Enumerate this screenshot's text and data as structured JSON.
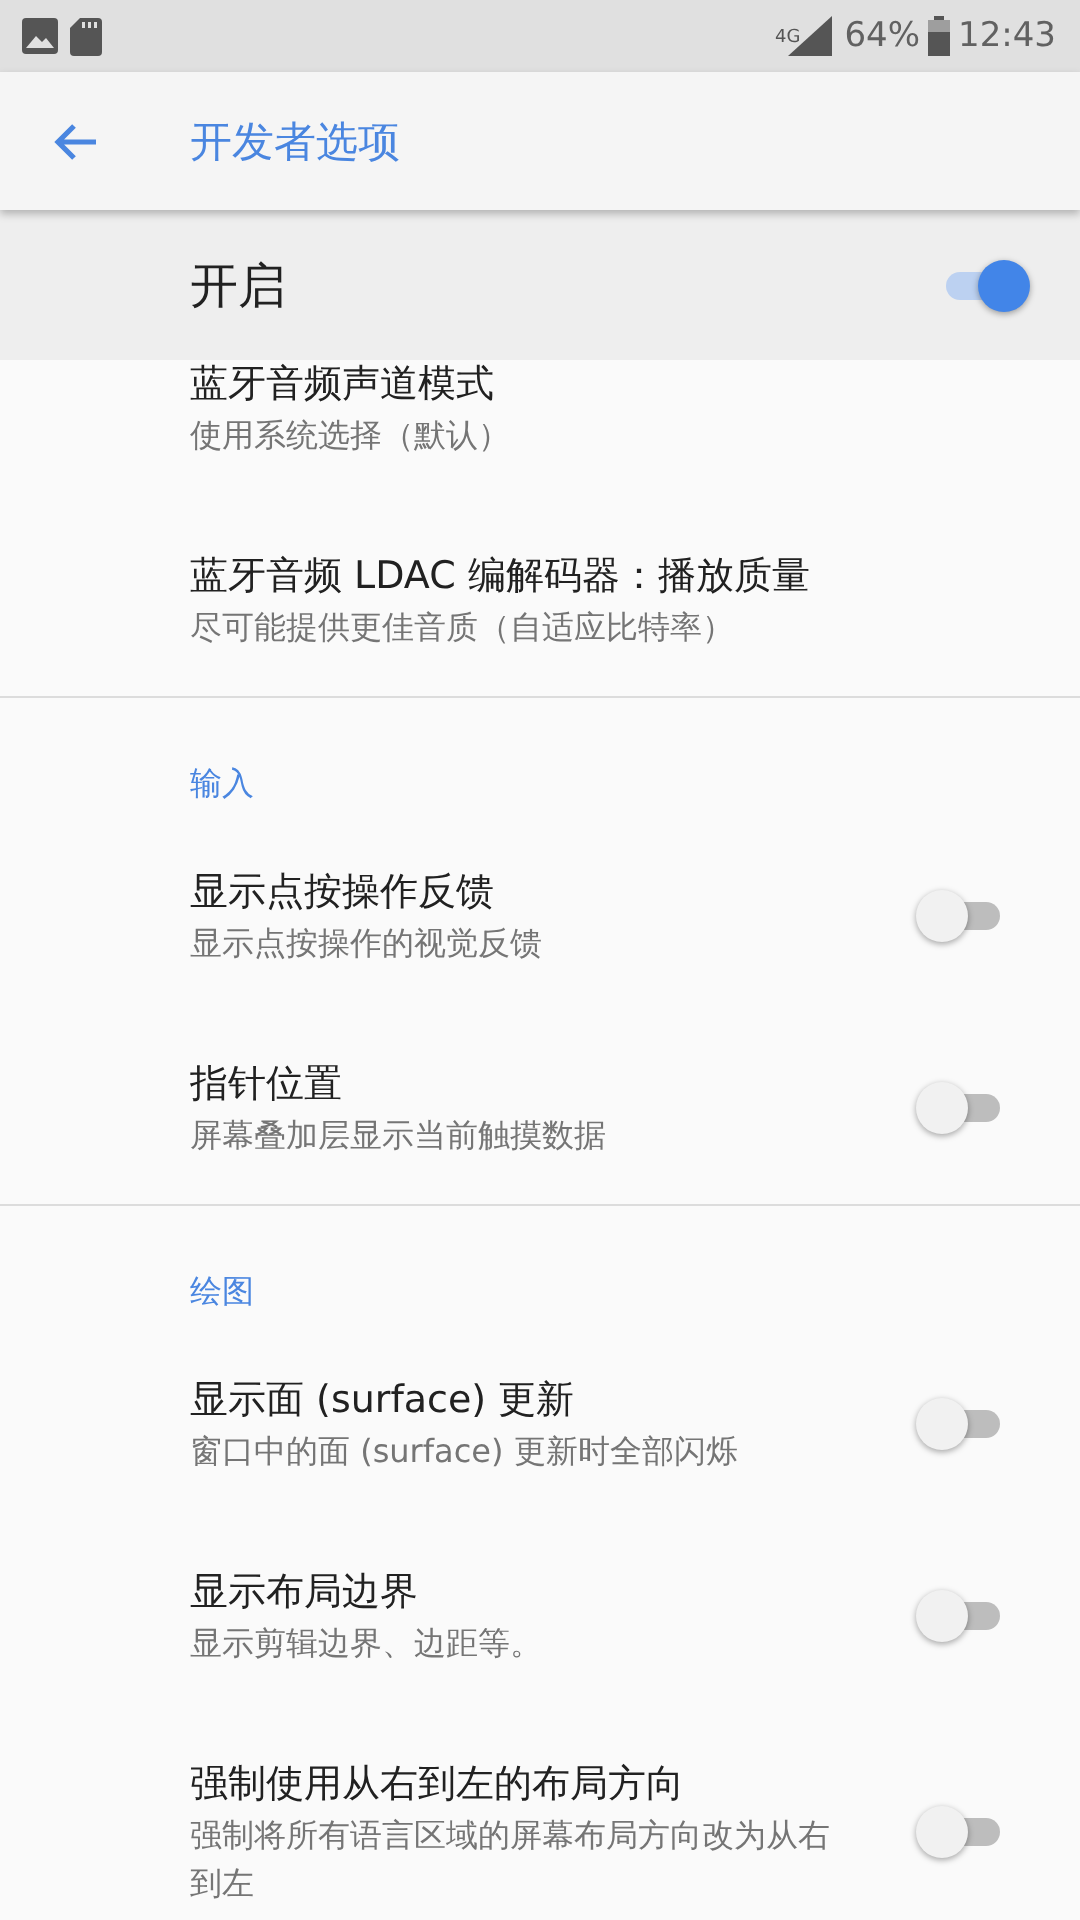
{
  "status_bar": {
    "network": "4G",
    "battery": "64%",
    "time": "12:43"
  },
  "toolbar": {
    "title": "开发者选项"
  },
  "master_switch": {
    "label": "开启",
    "on": true
  },
  "sections": [
    {
      "items": [
        {
          "title": "蓝牙音频声道模式",
          "subtitle": "使用系统选择（默认）",
          "kind": "plain"
        },
        {
          "title": "蓝牙音频 LDAC 编解码器：播放质量",
          "subtitle": "尽可能提供更佳音质（自适应比特率）",
          "kind": "plain"
        }
      ]
    },
    {
      "header": "输入",
      "items": [
        {
          "title": "显示点按操作反馈",
          "subtitle": "显示点按操作的视觉反馈",
          "kind": "switch",
          "on": false
        },
        {
          "title": "指针位置",
          "subtitle": "屏幕叠加层显示当前触摸数据",
          "kind": "switch",
          "on": false
        }
      ]
    },
    {
      "header": "绘图",
      "items": [
        {
          "title": "显示面 (surface) 更新",
          "subtitle": "窗口中的面 (surface) 更新时全部闪烁",
          "kind": "switch",
          "on": false
        },
        {
          "title": "显示布局边界",
          "subtitle": "显示剪辑边界、边距等。",
          "kind": "switch",
          "on": false
        },
        {
          "title": "强制使用从右到左的布局方向",
          "subtitle": "强制将所有语言区域的屏幕布局方向改为从右到左",
          "kind": "switch",
          "on": false
        }
      ]
    }
  ]
}
